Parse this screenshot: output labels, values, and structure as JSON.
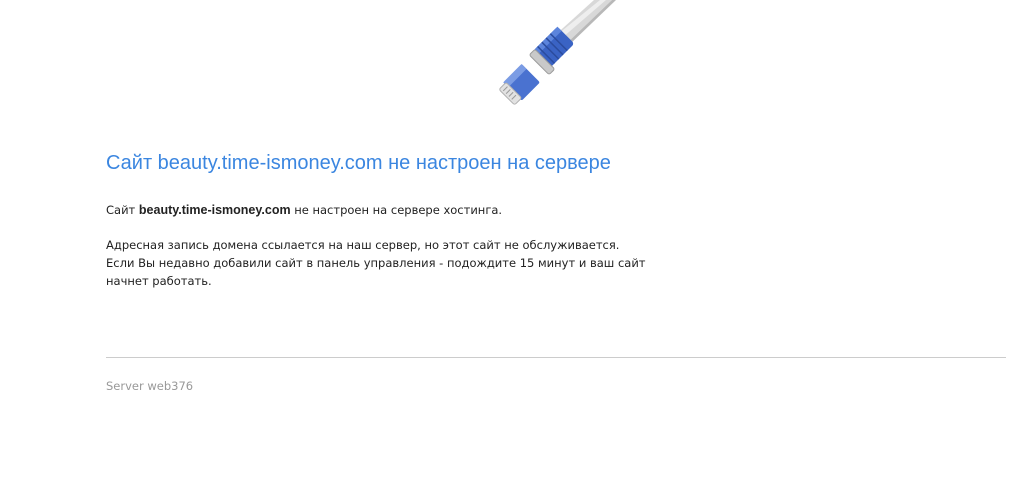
{
  "title": "Сайт beauty.time-ismoney.com не настроен на сервере",
  "message": {
    "line1_prefix": "Сайт",
    "domain": "beauty.time-ismoney.com",
    "line1_suffix": "не настроен на сервере хостинга.",
    "line2": "Адресная запись домена ссылается на наш сервер, но этот сайт не обслуживается.",
    "line3": "Если Вы недавно добавили сайт в панель управления - подождите 15 минут и ваш сайт начнет работать."
  },
  "footer": {
    "server": "Server web376"
  },
  "illustration": {
    "icon": "network-cable-icon"
  },
  "colors": {
    "heading": "#3b86e0",
    "text": "#222222",
    "muted": "#999999",
    "divider": "#cccccc",
    "connector": "#3a63c4"
  }
}
